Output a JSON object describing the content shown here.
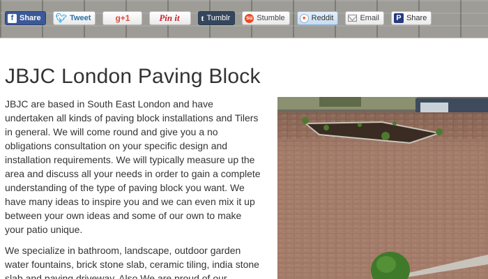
{
  "share_bar": {
    "buttons": [
      {
        "label": "Share",
        "icon": "facebook-icon"
      },
      {
        "label": "Tweet",
        "icon": "twitter-icon"
      },
      {
        "label": "g+1",
        "icon": "google-plus-icon"
      },
      {
        "label": "Pin it",
        "icon": "pinterest-icon"
      },
      {
        "label": "Tumblr",
        "icon": "tumblr-icon"
      },
      {
        "label": "Stumble",
        "icon": "stumbleupon-icon"
      },
      {
        "label": "Reddit",
        "icon": "reddit-icon"
      },
      {
        "label": "Email",
        "icon": "email-icon"
      },
      {
        "label": "Share",
        "icon": "printfriendly-icon"
      }
    ]
  },
  "main": {
    "title": "JBJC London Paving Block",
    "paragraphs": [
      "JBJC are based in South East London and have undertaken all kinds of paving block installations and Tilers in general. We will come round and give you a no obligations consultation on your specific design and installation requirements. We will typically measure up the area and discuss all your needs in order to gain a complete understanding of the type of paving block you want. We have many ideas to inspire you and we can even mix it up between your own ideas and some of our own to make your patio unique.",
      "We specialize in bathroom, landscape, outdoor garden water fountains, brick stone slab, ceramic tiling, india stone slab and paving driveway. Also We are proud of our"
    ],
    "photo": {
      "subject": "block-paved-driveway-photo"
    }
  },
  "colors": {
    "facebook": "#3b5998",
    "tumblr": "#35465c",
    "text": "#333333"
  }
}
